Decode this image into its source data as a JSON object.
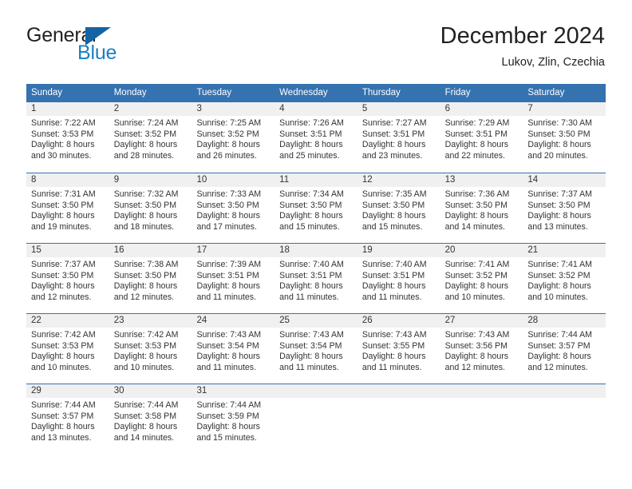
{
  "brand": {
    "name_part1": "General",
    "name_part2": "Blue",
    "color_dark": "#231f20",
    "color_blue": "#1a7fc1"
  },
  "header": {
    "title": "December 2024",
    "subtitle": "Lukov, Zlin, Czechia"
  },
  "calendar": {
    "header_bg": "#3572b0",
    "daynum_band_bg": "#f0f0f0",
    "weekday_headers": [
      "Sunday",
      "Monday",
      "Tuesday",
      "Wednesday",
      "Thursday",
      "Friday",
      "Saturday"
    ],
    "weeks": [
      [
        {
          "day": "1",
          "sunrise": "Sunrise: 7:22 AM",
          "sunset": "Sunset: 3:53 PM",
          "daylight1": "Daylight: 8 hours",
          "daylight2": "and 30 minutes."
        },
        {
          "day": "2",
          "sunrise": "Sunrise: 7:24 AM",
          "sunset": "Sunset: 3:52 PM",
          "daylight1": "Daylight: 8 hours",
          "daylight2": "and 28 minutes."
        },
        {
          "day": "3",
          "sunrise": "Sunrise: 7:25 AM",
          "sunset": "Sunset: 3:52 PM",
          "daylight1": "Daylight: 8 hours",
          "daylight2": "and 26 minutes."
        },
        {
          "day": "4",
          "sunrise": "Sunrise: 7:26 AM",
          "sunset": "Sunset: 3:51 PM",
          "daylight1": "Daylight: 8 hours",
          "daylight2": "and 25 minutes."
        },
        {
          "day": "5",
          "sunrise": "Sunrise: 7:27 AM",
          "sunset": "Sunset: 3:51 PM",
          "daylight1": "Daylight: 8 hours",
          "daylight2": "and 23 minutes."
        },
        {
          "day": "6",
          "sunrise": "Sunrise: 7:29 AM",
          "sunset": "Sunset: 3:51 PM",
          "daylight1": "Daylight: 8 hours",
          "daylight2": "and 22 minutes."
        },
        {
          "day": "7",
          "sunrise": "Sunrise: 7:30 AM",
          "sunset": "Sunset: 3:50 PM",
          "daylight1": "Daylight: 8 hours",
          "daylight2": "and 20 minutes."
        }
      ],
      [
        {
          "day": "8",
          "sunrise": "Sunrise: 7:31 AM",
          "sunset": "Sunset: 3:50 PM",
          "daylight1": "Daylight: 8 hours",
          "daylight2": "and 19 minutes."
        },
        {
          "day": "9",
          "sunrise": "Sunrise: 7:32 AM",
          "sunset": "Sunset: 3:50 PM",
          "daylight1": "Daylight: 8 hours",
          "daylight2": "and 18 minutes."
        },
        {
          "day": "10",
          "sunrise": "Sunrise: 7:33 AM",
          "sunset": "Sunset: 3:50 PM",
          "daylight1": "Daylight: 8 hours",
          "daylight2": "and 17 minutes."
        },
        {
          "day": "11",
          "sunrise": "Sunrise: 7:34 AM",
          "sunset": "Sunset: 3:50 PM",
          "daylight1": "Daylight: 8 hours",
          "daylight2": "and 15 minutes."
        },
        {
          "day": "12",
          "sunrise": "Sunrise: 7:35 AM",
          "sunset": "Sunset: 3:50 PM",
          "daylight1": "Daylight: 8 hours",
          "daylight2": "and 15 minutes."
        },
        {
          "day": "13",
          "sunrise": "Sunrise: 7:36 AM",
          "sunset": "Sunset: 3:50 PM",
          "daylight1": "Daylight: 8 hours",
          "daylight2": "and 14 minutes."
        },
        {
          "day": "14",
          "sunrise": "Sunrise: 7:37 AM",
          "sunset": "Sunset: 3:50 PM",
          "daylight1": "Daylight: 8 hours",
          "daylight2": "and 13 minutes."
        }
      ],
      [
        {
          "day": "15",
          "sunrise": "Sunrise: 7:37 AM",
          "sunset": "Sunset: 3:50 PM",
          "daylight1": "Daylight: 8 hours",
          "daylight2": "and 12 minutes."
        },
        {
          "day": "16",
          "sunrise": "Sunrise: 7:38 AM",
          "sunset": "Sunset: 3:50 PM",
          "daylight1": "Daylight: 8 hours",
          "daylight2": "and 12 minutes."
        },
        {
          "day": "17",
          "sunrise": "Sunrise: 7:39 AM",
          "sunset": "Sunset: 3:51 PM",
          "daylight1": "Daylight: 8 hours",
          "daylight2": "and 11 minutes."
        },
        {
          "day": "18",
          "sunrise": "Sunrise: 7:40 AM",
          "sunset": "Sunset: 3:51 PM",
          "daylight1": "Daylight: 8 hours",
          "daylight2": "and 11 minutes."
        },
        {
          "day": "19",
          "sunrise": "Sunrise: 7:40 AM",
          "sunset": "Sunset: 3:51 PM",
          "daylight1": "Daylight: 8 hours",
          "daylight2": "and 11 minutes."
        },
        {
          "day": "20",
          "sunrise": "Sunrise: 7:41 AM",
          "sunset": "Sunset: 3:52 PM",
          "daylight1": "Daylight: 8 hours",
          "daylight2": "and 10 minutes."
        },
        {
          "day": "21",
          "sunrise": "Sunrise: 7:41 AM",
          "sunset": "Sunset: 3:52 PM",
          "daylight1": "Daylight: 8 hours",
          "daylight2": "and 10 minutes."
        }
      ],
      [
        {
          "day": "22",
          "sunrise": "Sunrise: 7:42 AM",
          "sunset": "Sunset: 3:53 PM",
          "daylight1": "Daylight: 8 hours",
          "daylight2": "and 10 minutes."
        },
        {
          "day": "23",
          "sunrise": "Sunrise: 7:42 AM",
          "sunset": "Sunset: 3:53 PM",
          "daylight1": "Daylight: 8 hours",
          "daylight2": "and 10 minutes."
        },
        {
          "day": "24",
          "sunrise": "Sunrise: 7:43 AM",
          "sunset": "Sunset: 3:54 PM",
          "daylight1": "Daylight: 8 hours",
          "daylight2": "and 11 minutes."
        },
        {
          "day": "25",
          "sunrise": "Sunrise: 7:43 AM",
          "sunset": "Sunset: 3:54 PM",
          "daylight1": "Daylight: 8 hours",
          "daylight2": "and 11 minutes."
        },
        {
          "day": "26",
          "sunrise": "Sunrise: 7:43 AM",
          "sunset": "Sunset: 3:55 PM",
          "daylight1": "Daylight: 8 hours",
          "daylight2": "and 11 minutes."
        },
        {
          "day": "27",
          "sunrise": "Sunrise: 7:43 AM",
          "sunset": "Sunset: 3:56 PM",
          "daylight1": "Daylight: 8 hours",
          "daylight2": "and 12 minutes."
        },
        {
          "day": "28",
          "sunrise": "Sunrise: 7:44 AM",
          "sunset": "Sunset: 3:57 PM",
          "daylight1": "Daylight: 8 hours",
          "daylight2": "and 12 minutes."
        }
      ],
      [
        {
          "day": "29",
          "sunrise": "Sunrise: 7:44 AM",
          "sunset": "Sunset: 3:57 PM",
          "daylight1": "Daylight: 8 hours",
          "daylight2": "and 13 minutes."
        },
        {
          "day": "30",
          "sunrise": "Sunrise: 7:44 AM",
          "sunset": "Sunset: 3:58 PM",
          "daylight1": "Daylight: 8 hours",
          "daylight2": "and 14 minutes."
        },
        {
          "day": "31",
          "sunrise": "Sunrise: 7:44 AM",
          "sunset": "Sunset: 3:59 PM",
          "daylight1": "Daylight: 8 hours",
          "daylight2": "and 15 minutes."
        },
        {
          "day": "",
          "sunrise": "",
          "sunset": "",
          "daylight1": "",
          "daylight2": ""
        },
        {
          "day": "",
          "sunrise": "",
          "sunset": "",
          "daylight1": "",
          "daylight2": ""
        },
        {
          "day": "",
          "sunrise": "",
          "sunset": "",
          "daylight1": "",
          "daylight2": ""
        },
        {
          "day": "",
          "sunrise": "",
          "sunset": "",
          "daylight1": "",
          "daylight2": ""
        }
      ]
    ]
  }
}
